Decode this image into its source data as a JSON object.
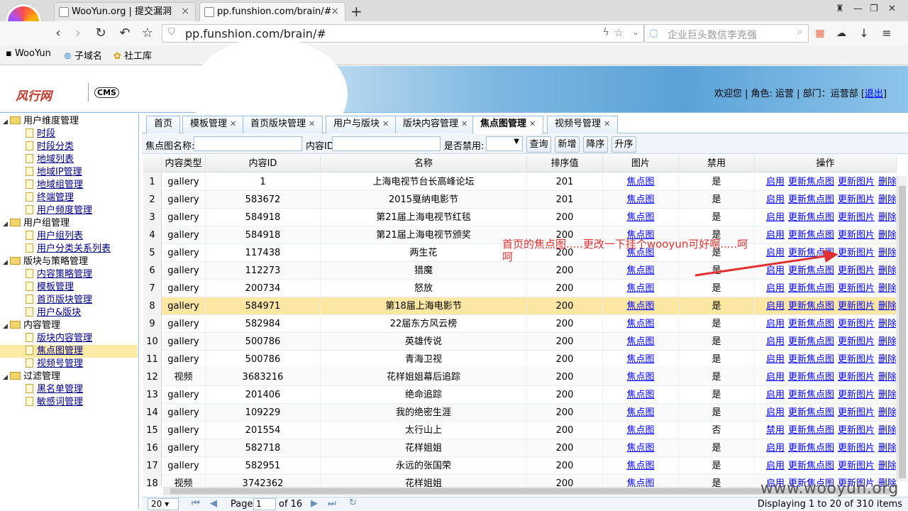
{
  "browser": {
    "tabs": [
      {
        "label": "WooYun.org | 提交漏洞"
      },
      {
        "label": "pp.funshion.com/brain/#"
      }
    ],
    "url": "pp.funshion.com/brain/#",
    "search_placeholder": "企业巨头数信李克强",
    "bookmarks": [
      "WooYun",
      "子域名",
      "社工库"
    ]
  },
  "header": {
    "brand": "风行网",
    "cms": "CMS",
    "user_prefix": "欢迎您 | 角色: 运营 | 部门：运营部 [",
    "logout": "退出",
    "user_suffix": "]"
  },
  "tree": [
    {
      "type": "group",
      "label": "用户维度管理"
    },
    {
      "type": "leaf",
      "label": "时段"
    },
    {
      "type": "leaf",
      "label": "时段分类"
    },
    {
      "type": "leaf",
      "label": "地域列表"
    },
    {
      "type": "leaf",
      "label": "地域IP管理"
    },
    {
      "type": "leaf",
      "label": "地域组管理"
    },
    {
      "type": "leaf",
      "label": "终端管理"
    },
    {
      "type": "leaf",
      "label": "用户频度管理"
    },
    {
      "type": "group",
      "label": "用户组管理"
    },
    {
      "type": "leaf",
      "label": "用户组列表"
    },
    {
      "type": "leaf",
      "label": "用户分类关系列表"
    },
    {
      "type": "group",
      "label": "版块与策略管理"
    },
    {
      "type": "leaf",
      "label": "内容策略管理"
    },
    {
      "type": "leaf",
      "label": "模板管理"
    },
    {
      "type": "leaf",
      "label": "首页版块管理"
    },
    {
      "type": "leaf",
      "label": "用户&版块"
    },
    {
      "type": "group",
      "label": "内容管理"
    },
    {
      "type": "leaf",
      "label": "版块内容管理"
    },
    {
      "type": "leaf",
      "label": "焦点图管理",
      "selected": true
    },
    {
      "type": "leaf",
      "label": "视频号管理"
    },
    {
      "type": "group",
      "label": "过滤管理"
    },
    {
      "type": "leaf",
      "label": "黑名单管理"
    },
    {
      "type": "leaf",
      "label": "敏感词管理"
    }
  ],
  "main_tabs": [
    {
      "label": "首页",
      "closable": false
    },
    {
      "label": "模板管理",
      "closable": true
    },
    {
      "label": "首页版块管理",
      "closable": true
    },
    {
      "label": "用户与版块",
      "closable": true
    },
    {
      "label": "版块内容管理",
      "closable": true
    },
    {
      "label": "焦点图管理",
      "closable": true,
      "active": true
    },
    {
      "label": "视频号管理",
      "closable": true
    }
  ],
  "filter": {
    "name_label": "焦点图名称:",
    "id_label": "内容ID",
    "disabled_label": "是否禁用:",
    "buttons": [
      "查询",
      "新增",
      "降序",
      "升序"
    ]
  },
  "grid": {
    "columns": [
      "内容类型",
      "内容ID",
      "名称",
      "排序值",
      "图片",
      "禁用",
      "操作"
    ],
    "image_link": "焦点图",
    "op_links": [
      "更新焦点图",
      "更新图片",
      "删除"
    ],
    "rows": [
      {
        "n": "1",
        "type": "gallery",
        "id": "1",
        "name": "上海电视节台长高峰论坛",
        "sort": "201",
        "disabled": "是",
        "op": "启用"
      },
      {
        "n": "2",
        "type": "gallery",
        "id": "583672",
        "name": "2015戛纳电影节",
        "sort": "201",
        "disabled": "是",
        "op": "启用"
      },
      {
        "n": "3",
        "type": "gallery",
        "id": "584918",
        "name": "第21届上海电视节红毯",
        "sort": "200",
        "disabled": "是",
        "op": "启用"
      },
      {
        "n": "4",
        "type": "gallery",
        "id": "584918",
        "name": "第21届上海电视节颁奖",
        "sort": "200",
        "disabled": "是",
        "op": "启用"
      },
      {
        "n": "5",
        "type": "gallery",
        "id": "117438",
        "name": "两生花",
        "sort": "200",
        "disabled": "是",
        "op": "启用"
      },
      {
        "n": "6",
        "type": "gallery",
        "id": "112273",
        "name": "猎魔",
        "sort": "200",
        "disabled": "是",
        "op": "启用"
      },
      {
        "n": "7",
        "type": "gallery",
        "id": "200734",
        "name": "怒放",
        "sort": "200",
        "disabled": "是",
        "op": "启用"
      },
      {
        "n": "8",
        "type": "gallery",
        "id": "584971",
        "name": "第18届上海电影节",
        "sort": "200",
        "disabled": "是",
        "op": "启用",
        "highlight": true
      },
      {
        "n": "9",
        "type": "gallery",
        "id": "582984",
        "name": "22届东方风云榜",
        "sort": "200",
        "disabled": "是",
        "op": "启用"
      },
      {
        "n": "10",
        "type": "gallery",
        "id": "500786",
        "name": "英雄传说",
        "sort": "200",
        "disabled": "是",
        "op": "启用"
      },
      {
        "n": "11",
        "type": "gallery",
        "id": "500786",
        "name": "青海卫视",
        "sort": "200",
        "disabled": "是",
        "op": "启用"
      },
      {
        "n": "12",
        "type": "视频",
        "id": "3683216",
        "name": "花样姐姐幕后追踪",
        "sort": "200",
        "disabled": "是",
        "op": "启用"
      },
      {
        "n": "13",
        "type": "gallery",
        "id": "201406",
        "name": "绝命追踪",
        "sort": "200",
        "disabled": "是",
        "op": "启用"
      },
      {
        "n": "14",
        "type": "gallery",
        "id": "109229",
        "name": "我的绝密生涯",
        "sort": "200",
        "disabled": "是",
        "op": "启用"
      },
      {
        "n": "15",
        "type": "gallery",
        "id": "201554",
        "name": "太行山上",
        "sort": "200",
        "disabled": "否",
        "op": "禁用"
      },
      {
        "n": "16",
        "type": "gallery",
        "id": "582718",
        "name": "花样姐姐",
        "sort": "200",
        "disabled": "是",
        "op": "启用"
      },
      {
        "n": "17",
        "type": "gallery",
        "id": "582951",
        "name": "永远的张国荣",
        "sort": "200",
        "disabled": "是",
        "op": "启用"
      },
      {
        "n": "18",
        "type": "视频",
        "id": "3742362",
        "name": "花样姐姐",
        "sort": "200",
        "disabled": "是",
        "op": "启用"
      }
    ]
  },
  "pager": {
    "page_size": "20",
    "page_label": "Page",
    "page": "1",
    "of_label": "of 16",
    "displaying": "Displaying 1 to 20 of 310 items"
  },
  "annotation": "首页的焦点图.....更改一下挂个wooyun可好啊.....呵呵",
  "watermark": "www.wooyun.org",
  "colors": {
    "link": "#0000ff",
    "highlight_row": "#fbe6a2",
    "annotation": "#e03030"
  }
}
